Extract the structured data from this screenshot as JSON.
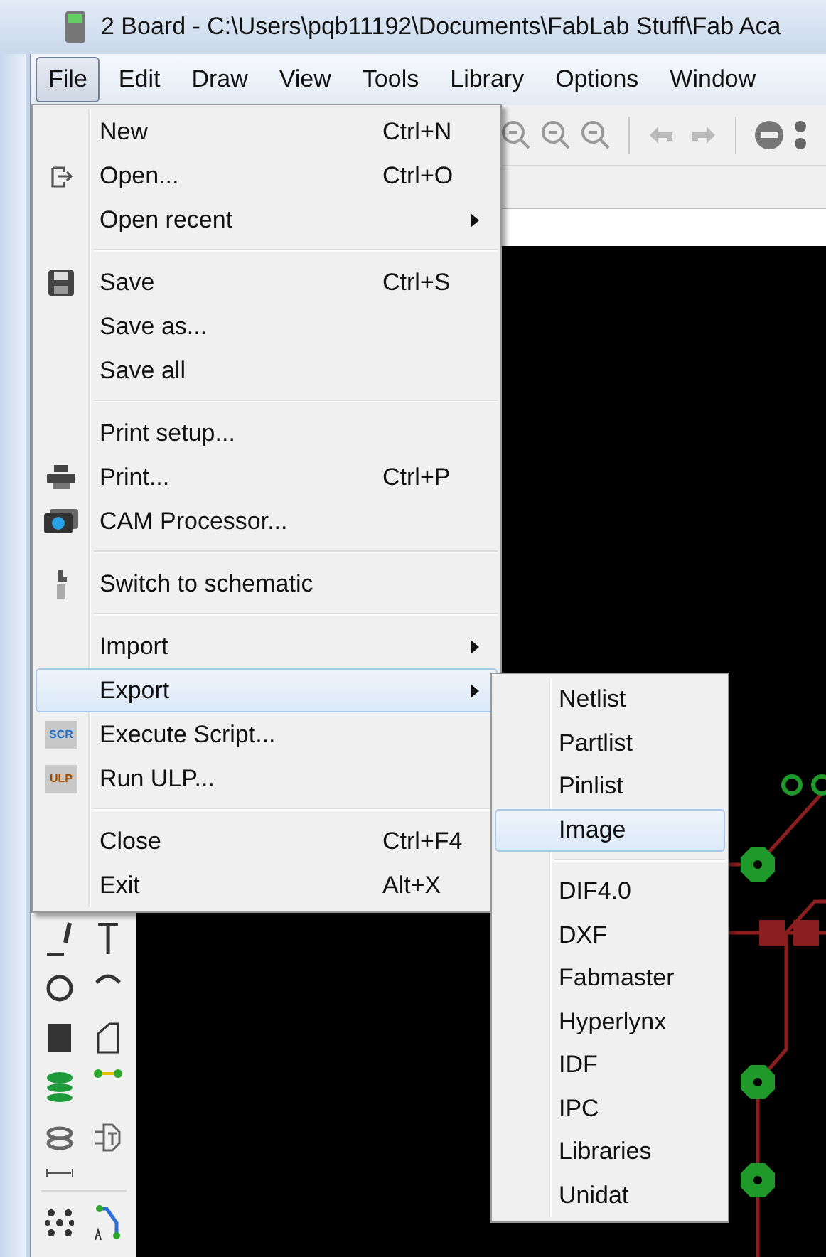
{
  "window": {
    "title": "2 Board - C:\\Users\\pqb11192\\Documents\\FabLab Stuff\\Fab Aca"
  },
  "menu_bar": [
    {
      "label": "File",
      "selected": true
    },
    {
      "label": "Edit",
      "selected": false
    },
    {
      "label": "Draw",
      "selected": false
    },
    {
      "label": "View",
      "selected": false
    },
    {
      "label": "Tools",
      "selected": false
    },
    {
      "label": "Library",
      "selected": false
    },
    {
      "label": "Options",
      "selected": false
    },
    {
      "label": "Window",
      "selected": false
    }
  ],
  "file_menu": [
    {
      "kind": "item",
      "label": "New",
      "shortcut": "Ctrl+N",
      "submenu": false,
      "selected": false
    },
    {
      "kind": "item",
      "label": "Open...",
      "shortcut": "Ctrl+O",
      "submenu": false,
      "selected": false
    },
    {
      "kind": "item",
      "label": "Open recent",
      "submenu": true,
      "selected": false
    },
    {
      "kind": "separator"
    },
    {
      "kind": "item",
      "label": "Save",
      "shortcut": "Ctrl+S",
      "submenu": false,
      "selected": false
    },
    {
      "kind": "item",
      "label": "Save as...",
      "submenu": false,
      "selected": false
    },
    {
      "kind": "item",
      "label": "Save all",
      "submenu": false,
      "selected": false
    },
    {
      "kind": "separator"
    },
    {
      "kind": "item",
      "label": "Print setup...",
      "submenu": false,
      "selected": false
    },
    {
      "kind": "item",
      "label": "Print...",
      "shortcut": "Ctrl+P",
      "submenu": false,
      "selected": false
    },
    {
      "kind": "item",
      "label": "CAM Processor...",
      "submenu": false,
      "selected": false
    },
    {
      "kind": "separator"
    },
    {
      "kind": "item",
      "label": "Switch to schematic",
      "submenu": false,
      "selected": false
    },
    {
      "kind": "separator"
    },
    {
      "kind": "item",
      "label": "Import",
      "submenu": true,
      "selected": false
    },
    {
      "kind": "item",
      "label": "Export",
      "submenu": true,
      "selected": true
    },
    {
      "kind": "item",
      "label": "Execute Script...",
      "icon_text": "SCR",
      "submenu": false,
      "selected": false
    },
    {
      "kind": "item",
      "label": "Run ULP...",
      "icon_text": "ULP",
      "submenu": false,
      "selected": false
    },
    {
      "kind": "separator"
    },
    {
      "kind": "item",
      "label": "Close",
      "shortcut": "Ctrl+F4",
      "submenu": false,
      "selected": false
    },
    {
      "kind": "item",
      "label": "Exit",
      "shortcut": "Alt+X",
      "submenu": false,
      "selected": false
    }
  ],
  "export_menu": [
    {
      "kind": "item",
      "label": "Netlist",
      "selected": false
    },
    {
      "kind": "item",
      "label": "Partlist",
      "selected": false
    },
    {
      "kind": "item",
      "label": "Pinlist",
      "selected": false
    },
    {
      "kind": "item",
      "label": "Image",
      "selected": true
    },
    {
      "kind": "separator"
    },
    {
      "kind": "item",
      "label": "DIF4.0",
      "selected": false
    },
    {
      "kind": "item",
      "label": "DXF",
      "selected": false
    },
    {
      "kind": "item",
      "label": "Fabmaster",
      "selected": false
    },
    {
      "kind": "item",
      "label": "Hyperlynx",
      "selected": false
    },
    {
      "kind": "item",
      "label": "IDF",
      "selected": false
    },
    {
      "kind": "item",
      "label": "IPC",
      "selected": false
    },
    {
      "kind": "item",
      "label": "Libraries",
      "selected": false
    },
    {
      "kind": "item",
      "label": "Unidat",
      "selected": false
    }
  ]
}
